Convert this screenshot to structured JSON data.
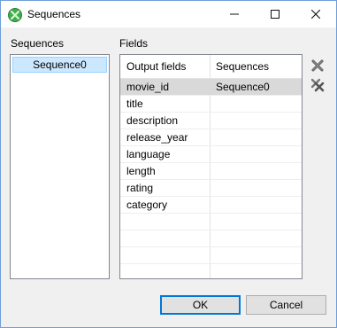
{
  "window": {
    "title": "Sequences",
    "controls": {
      "minimize": "—",
      "maximize": "☐",
      "close": "✕"
    }
  },
  "sequences_panel": {
    "label": "Sequences",
    "items": [
      {
        "label": "Sequence0",
        "selected": true
      }
    ]
  },
  "fields_panel": {
    "label": "Fields",
    "columns": [
      "Output fields",
      "Sequences"
    ],
    "rows": [
      {
        "field": "movie_id",
        "sequence": "Sequence0",
        "selected": true
      },
      {
        "field": "title",
        "sequence": ""
      },
      {
        "field": "description",
        "sequence": ""
      },
      {
        "field": "release_year",
        "sequence": ""
      },
      {
        "field": "language",
        "sequence": ""
      },
      {
        "field": "length",
        "sequence": ""
      },
      {
        "field": "rating",
        "sequence": ""
      },
      {
        "field": "category",
        "sequence": ""
      },
      {
        "field": "",
        "sequence": ""
      },
      {
        "field": "",
        "sequence": ""
      },
      {
        "field": "",
        "sequence": ""
      },
      {
        "field": "",
        "sequence": ""
      }
    ],
    "side_buttons": [
      "delete-icon",
      "delete-all-icon"
    ]
  },
  "buttons": {
    "ok": "OK",
    "cancel": "Cancel"
  },
  "colors": {
    "selection": "#cce8ff",
    "row_selected": "#d9d9d9",
    "accent": "#0078d7",
    "icon_red": "#d64b4b"
  }
}
